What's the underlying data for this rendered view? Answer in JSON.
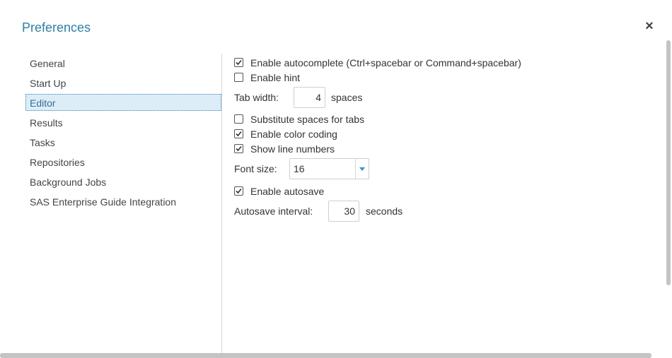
{
  "dialog": {
    "title": "Preferences",
    "close_label": "×"
  },
  "nav": {
    "items": [
      {
        "label": "General"
      },
      {
        "label": "Start Up"
      },
      {
        "label": "Editor"
      },
      {
        "label": "Results"
      },
      {
        "label": "Tasks"
      },
      {
        "label": "Repositories"
      },
      {
        "label": "Background Jobs"
      },
      {
        "label": "SAS Enterprise Guide Integration"
      }
    ],
    "active": "Editor"
  },
  "editor": {
    "autocomplete": {
      "label": "Enable autocomplete (Ctrl+spacebar or Command+spacebar)",
      "checked": true
    },
    "hint": {
      "label": "Enable hint",
      "checked": false
    },
    "tab_width": {
      "label": "Tab width:",
      "value": "4",
      "unit": "spaces"
    },
    "substitute_spaces": {
      "label": "Substitute spaces for tabs",
      "checked": false
    },
    "color_coding": {
      "label": "Enable color coding",
      "checked": true
    },
    "line_numbers": {
      "label": "Show line numbers",
      "checked": true
    },
    "font_size": {
      "label": "Font size:",
      "value": "16"
    },
    "autosave": {
      "label": "Enable autosave",
      "checked": true
    },
    "autosave_interval": {
      "label": "Autosave interval:",
      "value": "30",
      "unit": "seconds"
    }
  },
  "colors": {
    "title": "#2f7fa4",
    "nav_active_bg": "#dcedf8",
    "nav_active_border": "#3d7fb0",
    "select_arrow": "#3a8fc9"
  },
  "icons": {
    "close": "close-icon",
    "check": "checkmark-icon",
    "dropdown": "chevron-down-icon"
  }
}
